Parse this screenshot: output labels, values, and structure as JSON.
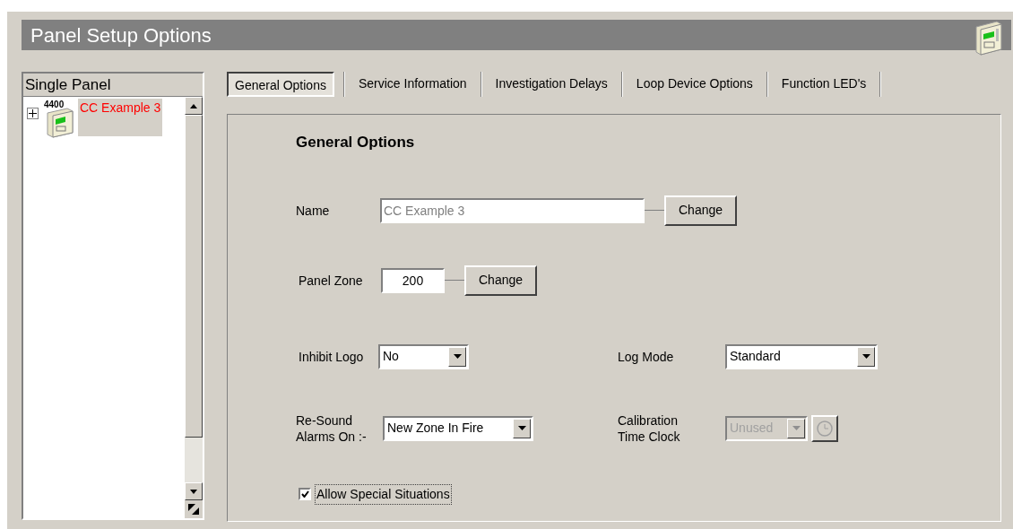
{
  "window": {
    "title": "Panel Setup Options"
  },
  "tree": {
    "header": "Single Panel",
    "items": [
      {
        "badge": "4400",
        "label": "CC Example 3",
        "selected": true,
        "expanded": false
      }
    ]
  },
  "tabs": [
    {
      "label": "General Options",
      "selected": true
    },
    {
      "label": "Service Information",
      "selected": false
    },
    {
      "label": "Investigation Delays",
      "selected": false
    },
    {
      "label": "Loop Device Options",
      "selected": false
    },
    {
      "label": "Function LED's",
      "selected": false
    }
  ],
  "general": {
    "heading": "General Options",
    "name": {
      "label": "Name",
      "value": "CC Example 3",
      "disabled": true,
      "button": "Change"
    },
    "panel_zone": {
      "label": "Panel Zone",
      "value": "200",
      "disabled": false,
      "button": "Change"
    },
    "inhibit_logo": {
      "label": "Inhibit Logo",
      "value": "No",
      "disabled": false
    },
    "log_mode": {
      "label": "Log Mode",
      "value": "Standard",
      "disabled": false
    },
    "resound": {
      "label": "Re-Sound\nAlarms On :-",
      "value": "New Zone In Fire",
      "disabled": false
    },
    "calibration": {
      "label": "Calibration\nTime Clock",
      "value": "Unused",
      "disabled": true
    },
    "allow_special": {
      "label": "Allow Special Situations",
      "checked": true
    }
  }
}
